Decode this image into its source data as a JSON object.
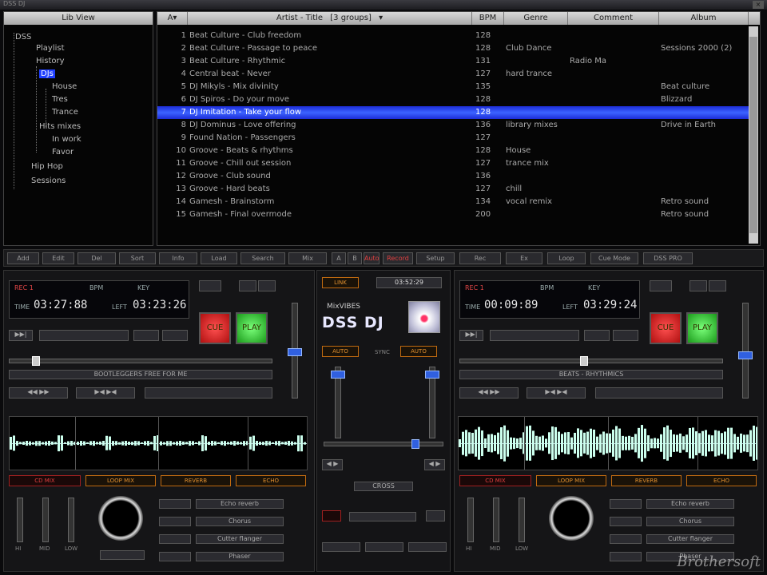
{
  "window": {
    "title": "DSS DJ"
  },
  "library": {
    "header": "Lib View",
    "items": [
      {
        "label": "DSS"
      },
      {
        "label": "Playlist"
      },
      {
        "label": "History"
      },
      {
        "label": "DJs"
      },
      {
        "label": "House"
      },
      {
        "label": "Tres"
      },
      {
        "label": "Trance"
      },
      {
        "label": "Hits mixes"
      },
      {
        "label": "In work"
      },
      {
        "label": "Favor"
      },
      {
        "label": "Hip Hop"
      },
      {
        "label": "Sessions"
      }
    ]
  },
  "tracks": {
    "header": {
      "sort": "A▾",
      "title": "Artist - Title",
      "group": "[3 groups]",
      "bpm": "BPM",
      "genre": "Genre",
      "comment": "Comment",
      "album": "Album"
    },
    "rows": [
      {
        "n": "1",
        "title": "Beat Culture - Club freedom",
        "bpm": "128",
        "genre": "",
        "comment": "",
        "album": ""
      },
      {
        "n": "2",
        "title": "Beat Culture - Passage to peace",
        "bpm": "128",
        "genre": "Club Dance",
        "comment": "",
        "album": "Sessions 2000 (2)"
      },
      {
        "n": "3",
        "title": "Beat Culture - Rhythmic",
        "bpm": "131",
        "genre": "",
        "comment": "Radio Ma",
        "album": ""
      },
      {
        "n": "4",
        "title": "Central beat - Never",
        "bpm": "127",
        "genre": "hard trance",
        "comment": "",
        "album": ""
      },
      {
        "n": "5",
        "title": "DJ Mikyls - Mix divinity",
        "bpm": "135",
        "genre": "",
        "comment": "",
        "album": "Beat culture"
      },
      {
        "n": "6",
        "title": "DJ Spiros - Do your move",
        "bpm": "128",
        "genre": "",
        "comment": "",
        "album": "Blizzard"
      },
      {
        "n": "7",
        "title": "DJ Imitation - Take your flow",
        "bpm": "128",
        "genre": "",
        "comment": "",
        "album": ""
      },
      {
        "n": "8",
        "title": "DJ Dominus - Love offering",
        "bpm": "136",
        "genre": "library mixes",
        "comment": "",
        "album": "Drive in Earth"
      },
      {
        "n": "9",
        "title": "Found Nation - Passengers",
        "bpm": "127",
        "genre": "",
        "comment": "",
        "album": ""
      },
      {
        "n": "10",
        "title": "Groove - Beats & rhythms",
        "bpm": "128",
        "genre": "House",
        "comment": "",
        "album": ""
      },
      {
        "n": "11",
        "title": "Groove - Chill out session",
        "bpm": "127",
        "genre": "trance mix",
        "comment": "",
        "album": ""
      },
      {
        "n": "12",
        "title": "Groove - Club sound",
        "bpm": "136",
        "genre": "",
        "comment": "",
        "album": ""
      },
      {
        "n": "13",
        "title": "Groove - Hard beats",
        "bpm": "127",
        "genre": "chill",
        "comment": "",
        "album": ""
      },
      {
        "n": "14",
        "title": "Gamesh - Brainstorm",
        "bpm": "134",
        "genre": "vocal remix",
        "comment": "",
        "album": "Retro sound"
      },
      {
        "n": "15",
        "title": "Gamesh - Final overmode",
        "bpm": "200",
        "genre": "",
        "comment": "",
        "album": "Retro sound"
      }
    ],
    "selected_index": 6
  },
  "toolbar": {
    "buttons": [
      "Add",
      "Edit",
      "Del",
      "Sort",
      "Info",
      "Load",
      "Search",
      "Mix",
      "A",
      "B",
      "Auto",
      "Record",
      "Setup",
      "Rec",
      "Ex",
      "Loop",
      "Cue Mode",
      "DSS PRO"
    ]
  },
  "deck_left": {
    "mode": "REC 1",
    "bpm_lbl": "BPM",
    "pitch_lbl": "KEY",
    "time_lbl": "TIME",
    "time": "03:27:88",
    "left_lbl": "LEFT",
    "left": "03:23:26",
    "cue": "CUE",
    "play": "PLAY",
    "song": "BOOTLEGGERS FREE FOR ME",
    "bottom_btns": [
      "CD MIX",
      "LOOP MIX",
      "REVERB",
      "ECHO"
    ],
    "fx": [
      "Echo reverb",
      "Chorus",
      "Cutter flanger",
      "Phaser"
    ],
    "eq_labels": [
      "HI",
      "MID",
      "LOW"
    ]
  },
  "deck_right": {
    "mode": "REC 1",
    "bpm_lbl": "BPM",
    "pitch_lbl": "KEY",
    "time_lbl": "TIME",
    "time": "00:09:89",
    "left_lbl": "LEFT",
    "left": "03:29:24",
    "cue": "CUE",
    "play": "PLAY",
    "song": "BEATS - RHYTHMICS",
    "bottom_btns": [
      "CD MIX",
      "LOOP MIX",
      "REVERB",
      "ECHO"
    ],
    "fx": [
      "Echo reverb",
      "Chorus",
      "Cutter flanger",
      "Phaser"
    ],
    "eq_labels": [
      "HI",
      "MID",
      "LOW"
    ]
  },
  "mixer": {
    "top_left": "LINK",
    "top_right": "03:52:29",
    "brand_small": "MixVIBES",
    "brand": "DSS DJ",
    "mid_left": "AUTO",
    "mid_center": "SYNC",
    "mid_right": "AUTO",
    "bottom": "CROSS",
    "crossfade_pct": 78
  },
  "watermark": "Brothersoft",
  "colors": {
    "selection": "#3c63ff",
    "accent_red": "#e04040",
    "accent_orange": "#c06a10",
    "wave": "#cfe8ff"
  }
}
